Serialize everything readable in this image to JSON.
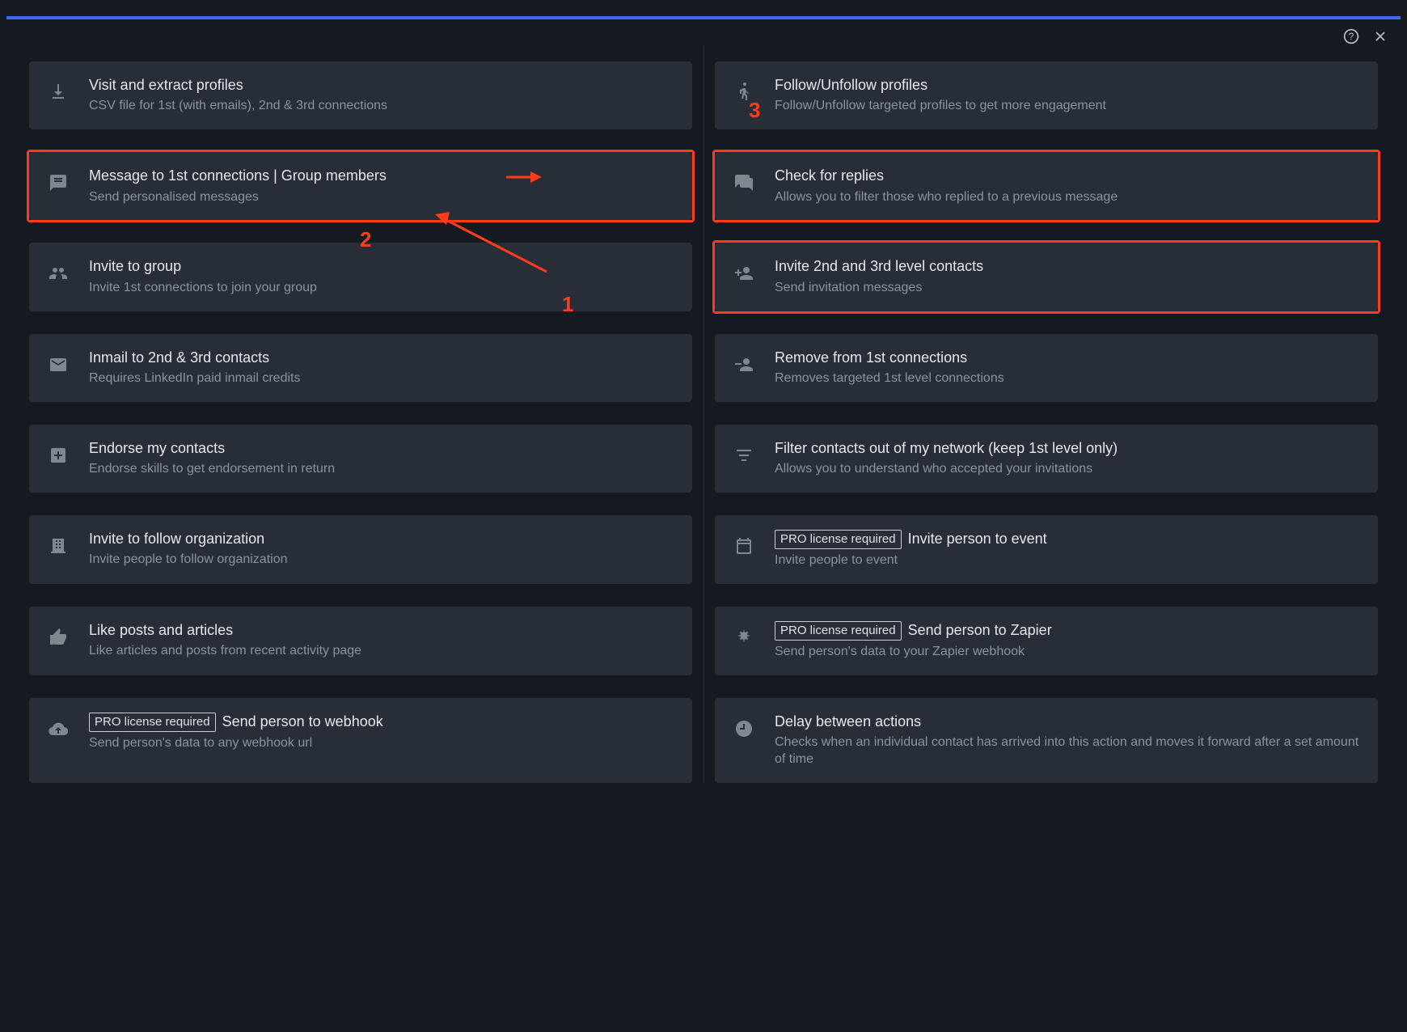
{
  "pro_badge_text": "PRO license required",
  "annotations": {
    "n1": "1",
    "n2": "2",
    "n3": "3"
  },
  "left": [
    {
      "icon": "download-icon",
      "title": "Visit and extract profiles",
      "desc": "CSV file for 1st (with emails), 2nd & 3rd connections"
    },
    {
      "icon": "message-icon",
      "title": "Message to 1st connections | Group members",
      "desc": "Send personalised messages",
      "highlight": true
    },
    {
      "icon": "group-icon",
      "title": "Invite to group",
      "desc": "Invite 1st connections to join your group"
    },
    {
      "icon": "mail-icon",
      "title": "Inmail to 2nd & 3rd contacts",
      "desc": "Requires LinkedIn paid inmail credits"
    },
    {
      "icon": "plus-box-icon",
      "title": "Endorse my contacts",
      "desc": "Endorse skills to get endorsement in return"
    },
    {
      "icon": "building-icon",
      "title": "Invite to follow organization",
      "desc": "Invite people to follow organization"
    },
    {
      "icon": "thumb-up-icon",
      "title": "Like posts and articles",
      "desc": "Like articles and posts from recent activity page"
    },
    {
      "icon": "cloud-upload-icon",
      "title": "Send person to webhook",
      "desc": "Send person's data to any webhook url",
      "pro": true
    }
  ],
  "right": [
    {
      "icon": "run-icon",
      "title": "Follow/Unfollow profiles",
      "desc": "Follow/Unfollow targeted profiles to get more engagement"
    },
    {
      "icon": "chat-icon",
      "title": "Check for replies",
      "desc": "Allows you to filter those who replied to a previous message",
      "highlight": true
    },
    {
      "icon": "person-add-icon",
      "title": "Invite 2nd and 3rd level contacts",
      "desc": "Send invitation messages",
      "highlight": true
    },
    {
      "icon": "person-remove-icon",
      "title": "Remove from 1st connections",
      "desc": "Removes targeted 1st level connections"
    },
    {
      "icon": "filter-icon",
      "title": "Filter contacts out of my network (keep 1st level only)",
      "desc": "Allows you to understand who accepted your invitations"
    },
    {
      "icon": "calendar-icon",
      "title": "Invite person to event",
      "desc": "Invite people to event",
      "pro": true
    },
    {
      "icon": "zapier-icon",
      "title": "Send person to Zapier",
      "desc": "Send person's data to your Zapier webhook",
      "pro": true
    },
    {
      "icon": "clock-icon",
      "title": "Delay between actions",
      "desc": "Checks when an individual contact has arrived into this action and moves it forward after a set amount of time"
    }
  ]
}
